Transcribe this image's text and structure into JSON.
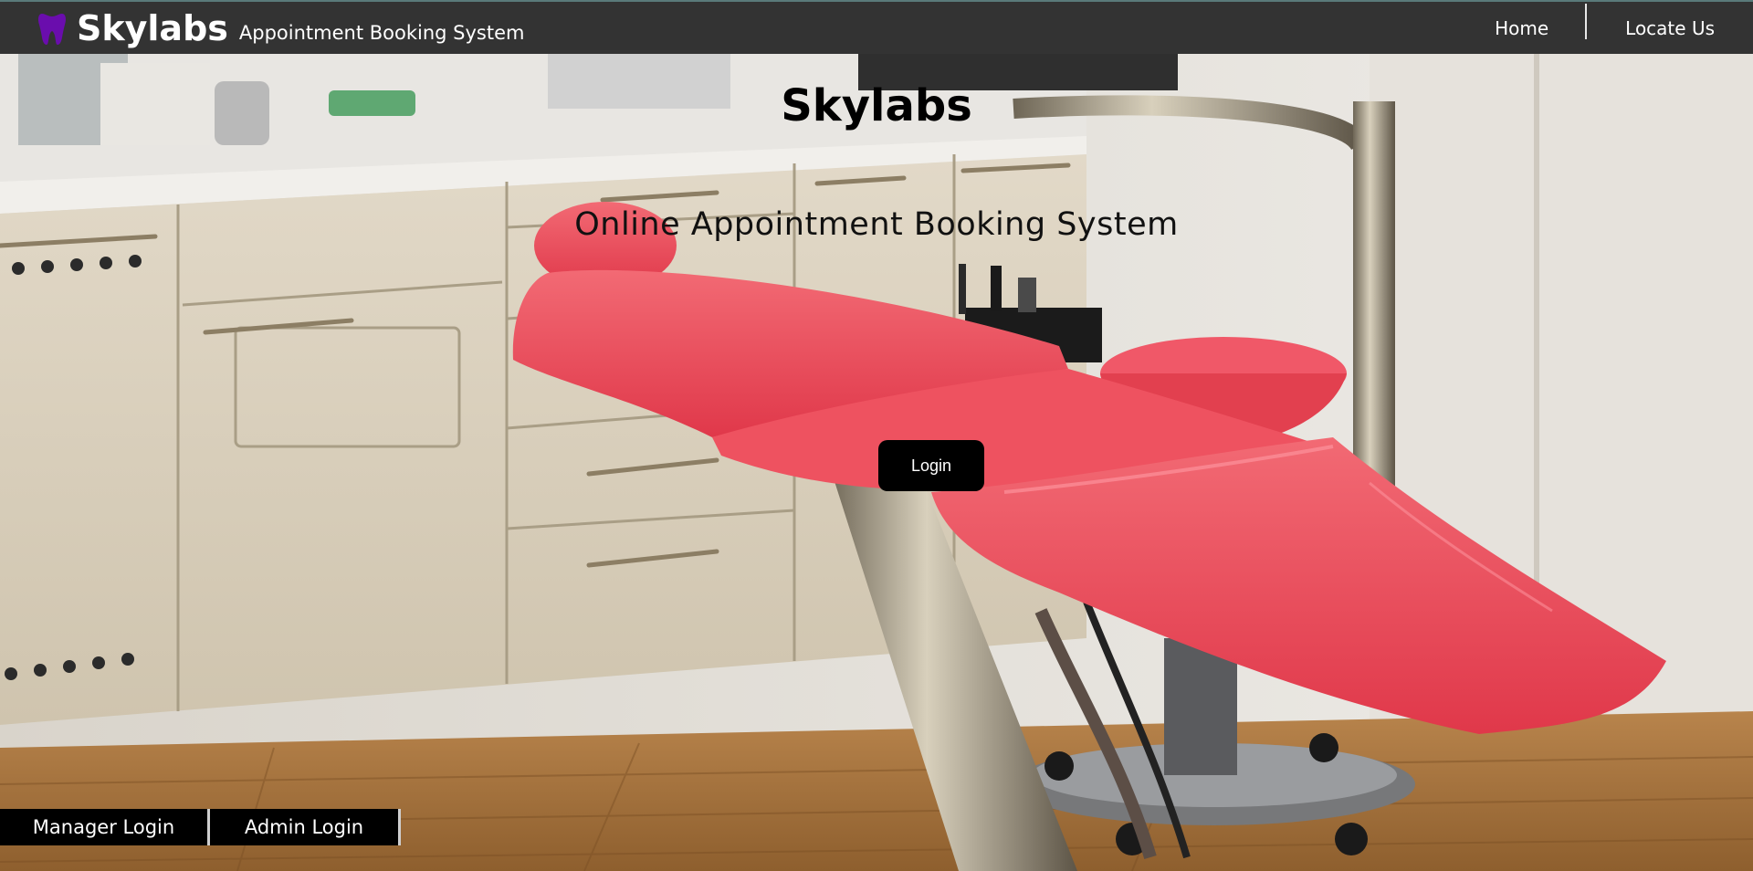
{
  "header": {
    "brand_name": "Skylabs",
    "brand_subtitle": "Appointment Booking System",
    "logo_icon": "tooth-icon",
    "logo_color": "#6a0dad",
    "nav": [
      {
        "label": "Home"
      },
      {
        "label": "Locate Us"
      }
    ]
  },
  "hero": {
    "title": "Skylabs",
    "subtitle": "Online Appointment Booking System",
    "login_label": "Login"
  },
  "footer_buttons": {
    "manager_label": "Manager Login",
    "admin_label": "Admin Login"
  }
}
